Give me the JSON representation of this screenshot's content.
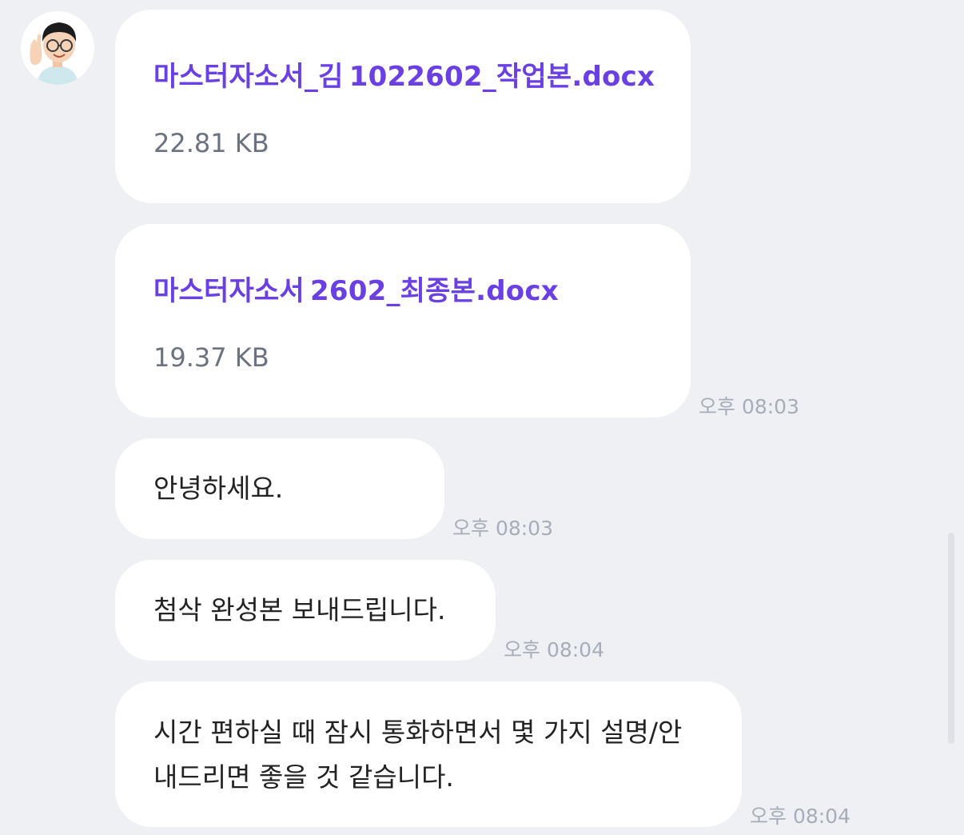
{
  "sender": {
    "avatar_icon": "memoji-waving-avatar"
  },
  "messages": [
    {
      "type": "file",
      "file_name": "마스터자소서_김  1022602_작업본.docx",
      "file_size": "22.81 KB"
    },
    {
      "type": "file",
      "file_name": "마스터자소서  2602_최종본.docx",
      "file_size": "19.37 KB",
      "time": "오후 08:03"
    },
    {
      "type": "text",
      "text": "안녕하세요.",
      "time": "오후 08:03"
    },
    {
      "type": "text",
      "text": "첨삭 완성본 보내드립니다.",
      "time": "오후 08:04"
    },
    {
      "type": "text",
      "lines": [
        "시간 편하실 때 잠시 통화하면서 몇 가지 설명/안",
        "내드리면 좋을 것 같습니다."
      ],
      "time": "오후 08:04"
    }
  ],
  "colors": {
    "background": "#eef0f4",
    "bubble": "#ffffff",
    "file_link": "#6a3fe3",
    "meta_text": "#a7adb8"
  }
}
